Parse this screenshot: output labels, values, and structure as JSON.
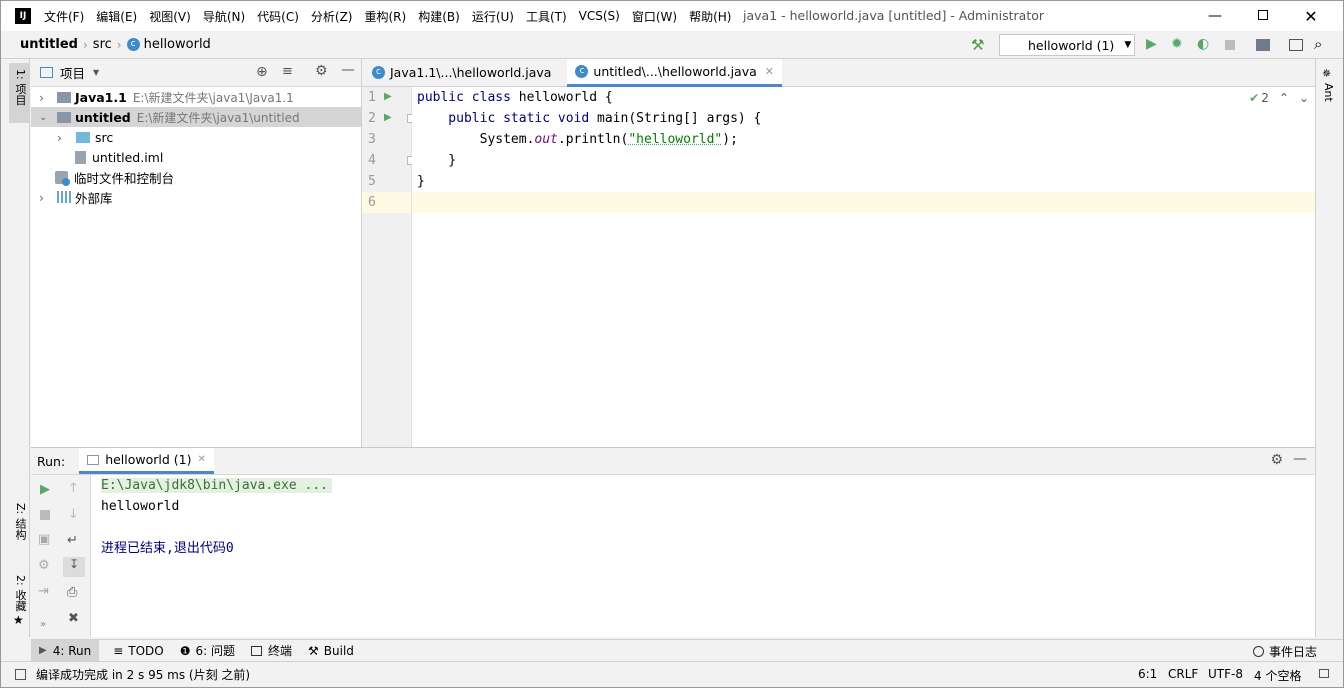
{
  "window": {
    "title": "java1 - helloworld.java [untitled] - Administrator",
    "app_logo": "IJ"
  },
  "menu": [
    "文件(F)",
    "编辑(E)",
    "视图(V)",
    "导航(N)",
    "代码(C)",
    "分析(Z)",
    "重构(R)",
    "构建(B)",
    "运行(U)",
    "工具(T)",
    "VCS(S)",
    "窗口(W)",
    "帮助(H)"
  ],
  "breadcrumb": {
    "project": "untitled",
    "folder": "src",
    "file": "helloworld"
  },
  "run_config": {
    "label": "helloworld (1)"
  },
  "project_panel": {
    "title": "项目",
    "tree": [
      {
        "label": "Java1.1",
        "path": "E:\\新建文件夹\\java1\\Java1.1"
      },
      {
        "label": "untitled",
        "path": "E:\\新建文件夹\\java1\\untitled"
      },
      {
        "label": "src"
      },
      {
        "label": "untitled.iml"
      },
      {
        "label": "临时文件和控制台"
      },
      {
        "label": "外部库"
      }
    ]
  },
  "editor": {
    "tabs": [
      {
        "label": "Java1.1\\...\\helloworld.java"
      },
      {
        "label": "untitled\\...\\helloworld.java"
      }
    ],
    "line_numbers": [
      "1",
      "2",
      "3",
      "4",
      "5",
      "6"
    ],
    "inspection_count": "2",
    "code": {
      "l1_kw": "public class ",
      "l1_rest": "helloworld {",
      "l2_kw": "    public static void ",
      "l2_rest": "main(String[] args) {",
      "l3_a": "        System.",
      "l3_out": "out",
      "l3_b": ".println(",
      "l3_str": "\"helloworld\"",
      "l3_c": ");",
      "l4": "    }",
      "l5": "}"
    }
  },
  "run_panel": {
    "label": "Run:",
    "tab": "helloworld (1)",
    "console": [
      "E:\\Java\\jdk8\\bin\\java.exe ...",
      "helloworld",
      "",
      "进程已结束,退出代码0"
    ]
  },
  "left_stripe": {
    "project": "1: 项目",
    "structure": "Z: 结构",
    "favorites": "2: 收藏"
  },
  "right_stripe": {
    "ant": "Ant"
  },
  "bottom_tools": [
    "4: Run",
    "TODO",
    "6: 问题",
    "终端",
    "Build"
  ],
  "event_log": "事件日志",
  "status": {
    "message": "编译成功完成 in 2 s 95 ms (片刻 之前)",
    "position": "6:1",
    "line_sep": "CRLF",
    "encoding": "UTF-8",
    "indent": "4 个空格"
  },
  "colors": {
    "accent": "#4a88c7",
    "run_green": "#59a869",
    "current_line": "#fffae3"
  }
}
